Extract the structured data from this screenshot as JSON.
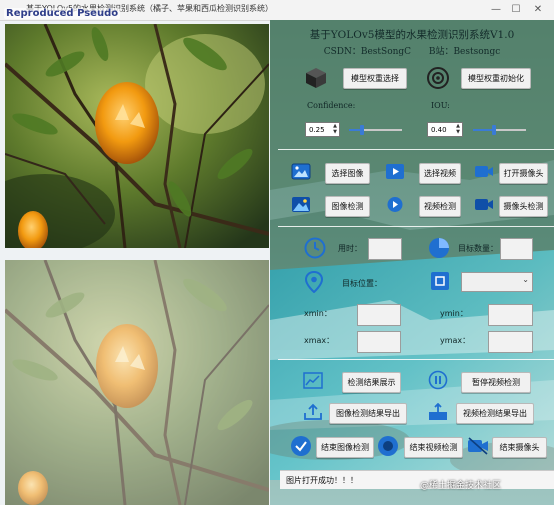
{
  "window": {
    "title": "基于YOLOv5的水果检测识别系统（橘子、苹果和西瓜检测识别系统）",
    "watermark": "Reproduced Pseudo"
  },
  "header": {
    "title": "基于YOLOv5模型的水果检测识别系统V1.0",
    "csdn": "CSDN：BestSongC",
    "bilibili": "B站：Bestsongc"
  },
  "model": {
    "select_label": "模型权重选择",
    "init_label": "模型权重初始化"
  },
  "params": {
    "confidence_label": "Confidence:",
    "confidence_value": "0.25",
    "confidence_level": 0.25,
    "iou_label": "IOU:",
    "iou_value": "0.40",
    "iou_level": 0.4
  },
  "input_buttons": {
    "select_image": "选择图像",
    "select_video": "选择视频",
    "open_camera": "打开摄像头",
    "image_detect": "图像检测",
    "video_detect": "视频检测",
    "camera_detect": "摄像头检测"
  },
  "results": {
    "time_label": "用时：",
    "target_count_label": "目标数量：",
    "target_position_label": "目标位置：",
    "xmin_label": "xmin：",
    "ymin_label": "ymin：",
    "xmax_label": "xmax：",
    "ymax_label": "ymax："
  },
  "actions": {
    "show_results": "检测结果展示",
    "pause_video": "暂停视频检测",
    "export_image": "图像检测结果导出",
    "export_video": "视频检测结果导出",
    "end_image": "结束图像检测",
    "end_video": "结束视频检测",
    "end_camera": "结束摄像头"
  },
  "status": {
    "message": "图片打开成功！！！"
  },
  "corner_watermark": "@稀土掘金技术社区",
  "colors": {
    "accent": "#3a7bd5",
    "header_text": "#132b2a"
  }
}
